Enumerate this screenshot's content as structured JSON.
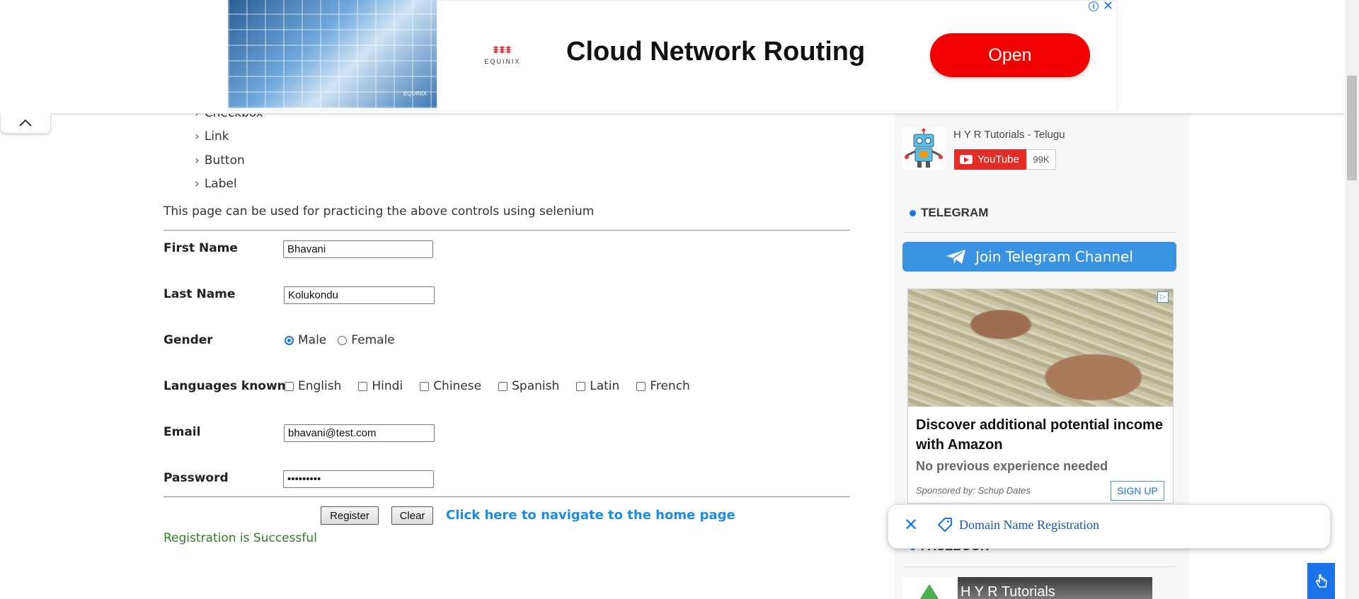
{
  "ad_banner": {
    "headline": "Cloud Network Routing",
    "button_label": "Open",
    "brand_mark": "⩨⩨⩨",
    "brand_name": "EQUINIX",
    "image_logo": "EQUINIX",
    "info_icon": "i",
    "close_icon": "✕"
  },
  "nav": {
    "items": [
      "Checkbox",
      "Link",
      "Button",
      "Label"
    ]
  },
  "intro_text": "This page can be used for practicing the above controls using selenium",
  "form": {
    "first_name_label": "First Name",
    "first_name_value": "Bhavani",
    "last_name_label": "Last Name",
    "last_name_value": "Kolukondu",
    "gender_label": "Gender",
    "gender_options": [
      "Male",
      "Female"
    ],
    "gender_selected": "Male",
    "languages_label": "Languages known",
    "languages": [
      "English",
      "Hindi",
      "Chinese",
      "Spanish",
      "Latin",
      "French"
    ],
    "email_label": "Email",
    "email_value": "bhavani@test.com",
    "password_label": "Password",
    "password_value": "•••••••••",
    "register_label": "Register",
    "clear_label": "Clear",
    "home_link": "Click here to navigate to the home page",
    "success_message": "Registration is Successful"
  },
  "sidebar": {
    "youtube_channel": "H Y R Tutorials - Telugu",
    "youtube_label": "YouTube",
    "youtube_count": "99K",
    "telegram_heading": "TELEGRAM",
    "telegram_button": "Join Telegram Channel",
    "amazon_ad": {
      "headline": "Discover additional potential income with Amazon",
      "subtext": "No previous experience needed",
      "sponsor": "Sponsored by: Schup Dates",
      "button": "SIGN UP",
      "adchoice": "▷"
    },
    "facebook_heading": "FACEBOOK",
    "facebook_video_title": "H Y R Tutorials"
  },
  "popup": {
    "close_icon": "✕",
    "text": "Domain Name Registration"
  },
  "colors": {
    "accent": "#1a73e8",
    "ad_button": "#f20000",
    "success": "#2e7d22",
    "link": "#1a8ce3",
    "telegram": "#3a93e0"
  }
}
